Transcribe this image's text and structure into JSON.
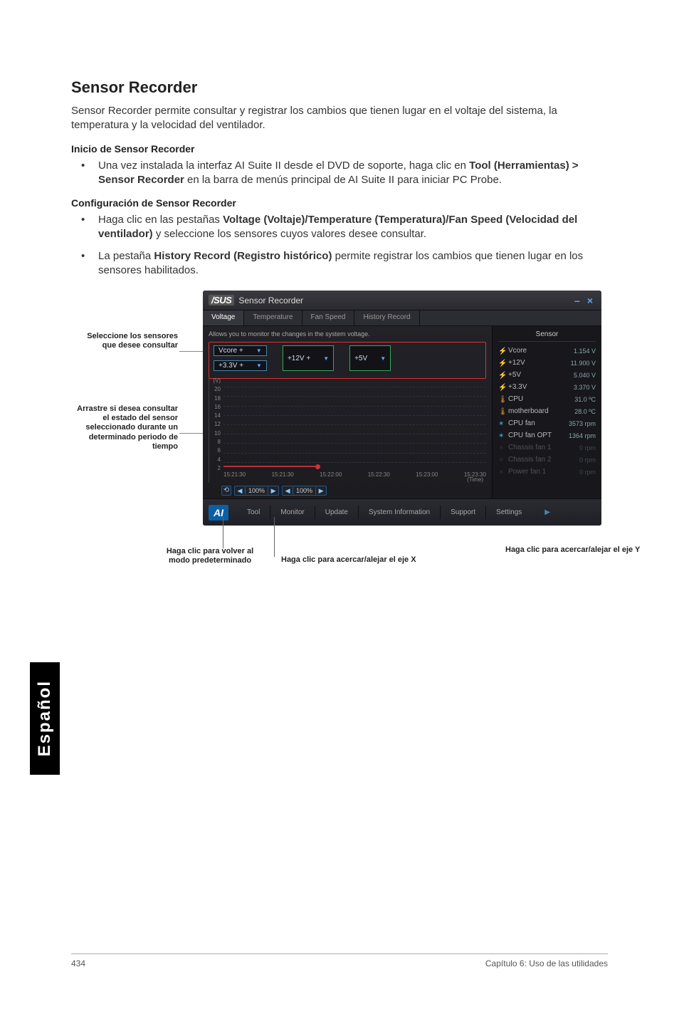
{
  "doc": {
    "title": "Sensor Recorder",
    "intro": "Sensor Recorder permite consultar y registrar los cambios que tienen lugar en el voltaje del sistema, la temperatura y la velocidad del ventilador.",
    "subhead1": "Inicio de Sensor Recorder",
    "bullet1_pre": "Una vez instalada la interfaz AI Suite II desde el DVD de soporte, haga clic en ",
    "bullet1_bold": "Tool (Herramientas) > Sensor Recorder",
    "bullet1_post": " en la barra de menús principal de AI Suite II para iniciar PC Probe.",
    "subhead2": "Configuración de Sensor Recorder",
    "bullet2_pre": "Haga clic en las pestañas ",
    "bullet2_bold": "Voltage (Voltaje)/Temperature (Temperatura)/Fan Speed (Velocidad del ventilador)",
    "bullet2_post": " y seleccione los sensores cuyos valores desee consultar.",
    "bullet3_pre": "La pestaña ",
    "bullet3_bold": "History Record (Registro histórico)",
    "bullet3_post": " permite registrar los cambios que tienen lugar en los sensores habilitados."
  },
  "labels": {
    "select": "Seleccione los sensores que desee consultar",
    "drag": "Arrastre si desea consultar el estado del sensor seleccionado durante un determinado periodo de tiempo",
    "reset": "Haga clic para volver al modo predeterminado",
    "zoomx": "Haga clic para acercar/alejar el eje X",
    "zoomy": "Haga clic para acercar/alejar el eje Y"
  },
  "shot": {
    "brand": "/SUS",
    "window_title": "Sensor Recorder",
    "tabs": [
      "Voltage",
      "Temperature",
      "Fan Speed",
      "History Record"
    ],
    "caption": "Allows you to monitor the changes in the system voltage.",
    "selects": [
      "Vcore +",
      "+12V +",
      "+5V"
    ],
    "sel_sub": "+3.3V +",
    "yaxis_unit": "(V)",
    "yticks": [
      "20",
      "18",
      "16",
      "14",
      "12",
      "10",
      "8",
      "6",
      "4",
      "2"
    ],
    "xticks": [
      "15:21:30",
      "15:21:30",
      "15:22:00",
      "15:22:30",
      "15:23:00",
      "15:23:30"
    ],
    "xunit": "(Time)",
    "zoom_x": "100%",
    "zoom_y": "100%",
    "side_title": "Sensor",
    "sensors": [
      {
        "icon": "bolt",
        "label": "Vcore",
        "value": "1.154 V"
      },
      {
        "icon": "bolt",
        "label": "+12V",
        "value": "11.900 V"
      },
      {
        "icon": "bolt",
        "label": "+5V",
        "value": "5.040 V"
      },
      {
        "icon": "bolt",
        "label": "+3.3V",
        "value": "3.370 V"
      },
      {
        "icon": "therm",
        "label": "CPU",
        "value": "31.0 ºC"
      },
      {
        "icon": "therm",
        "label": "motherboard",
        "value": "28.0 ºC"
      },
      {
        "icon": "fan",
        "label": "CPU fan",
        "value": "3573 rpm"
      },
      {
        "icon": "fan",
        "label": "CPU fan OPT",
        "value": "1364 rpm"
      },
      {
        "icon": "fan-dim",
        "label": "Chassis fan 1",
        "value": "0 rpm"
      },
      {
        "icon": "fan-dim",
        "label": "Chassis fan 2",
        "value": "0 rpm"
      },
      {
        "icon": "fan-dim",
        "label": "Power fan 1",
        "value": "0 rpm"
      }
    ],
    "bottom": {
      "logo": "AI",
      "buttons": [
        "Tool",
        "Monitor",
        "Update",
        "System Information",
        "Support",
        "Settings"
      ]
    },
    "win_minus": "–",
    "win_close": "×"
  },
  "chart_data": {
    "type": "line",
    "title": "System voltage monitor",
    "xlabel": "(Time)",
    "ylabel": "(V)",
    "ylim": [
      0,
      20
    ],
    "x": [
      "15:21:30",
      "15:21:30",
      "15:22:00",
      "15:22:30",
      "15:23:00",
      "15:23:30"
    ],
    "series": [
      {
        "name": "Vcore",
        "values": [
          1.15,
          1.15
        ],
        "color": "#b33"
      }
    ]
  },
  "side_tab": "Español",
  "footer": {
    "page": "434",
    "chapter": "Capítulo 6: Uso de las utilidades"
  }
}
